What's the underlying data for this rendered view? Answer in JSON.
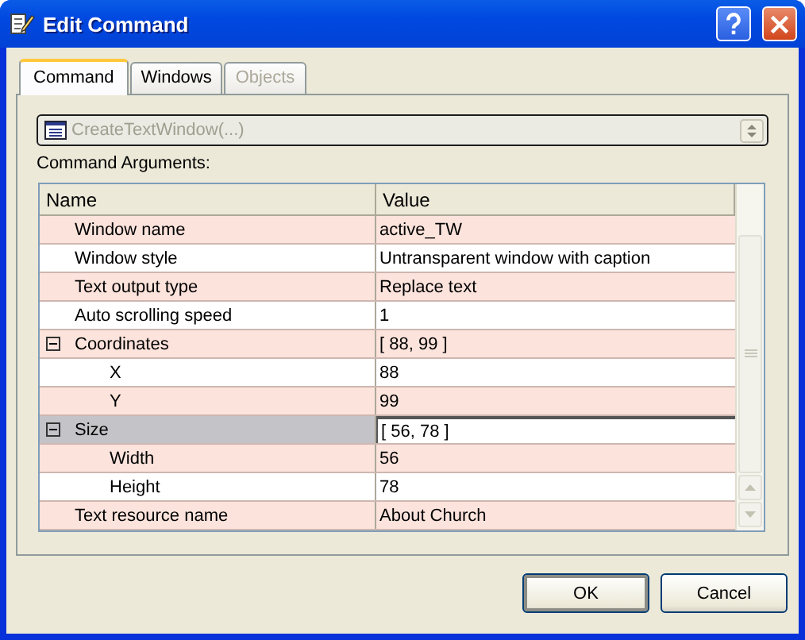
{
  "window": {
    "title": "Edit Command"
  },
  "tabs": [
    {
      "label": "Command",
      "selected": true,
      "disabled": false
    },
    {
      "label": "Windows",
      "selected": false,
      "disabled": false
    },
    {
      "label": "Objects",
      "selected": false,
      "disabled": true
    }
  ],
  "command_select": {
    "value": "CreateTextWindow(...)",
    "disabled": true
  },
  "arguments_label": "Command Arguments:",
  "grid": {
    "columns": [
      "Name",
      "Value"
    ],
    "rows": [
      {
        "name": "Window name",
        "value": "active_TW",
        "selected": false
      },
      {
        "name": "Window style",
        "value": "Untransparent window with caption",
        "selected": false
      },
      {
        "name": "Text output type",
        "value": "Replace text",
        "selected": false
      },
      {
        "name": "Auto scrolling speed",
        "value": "1",
        "selected": false
      },
      {
        "name": "Coordinates",
        "value": "[ 88, 99 ]",
        "selected": false,
        "expanded": true,
        "children": [
          {
            "name": "X",
            "value": "88",
            "selected": false
          },
          {
            "name": "Y",
            "value": "99",
            "selected": false
          }
        ]
      },
      {
        "name": "Size",
        "value": "[ 56, 78 ]",
        "selected": true,
        "expanded": true,
        "children": [
          {
            "name": "Width",
            "value": "56",
            "selected": false
          },
          {
            "name": "Height",
            "value": "78",
            "selected": false
          }
        ]
      },
      {
        "name": "Text resource name",
        "value": "About Church",
        "selected": false
      }
    ]
  },
  "buttons": [
    {
      "label": "OK",
      "default": true
    },
    {
      "label": "Cancel",
      "default": false
    }
  ]
}
